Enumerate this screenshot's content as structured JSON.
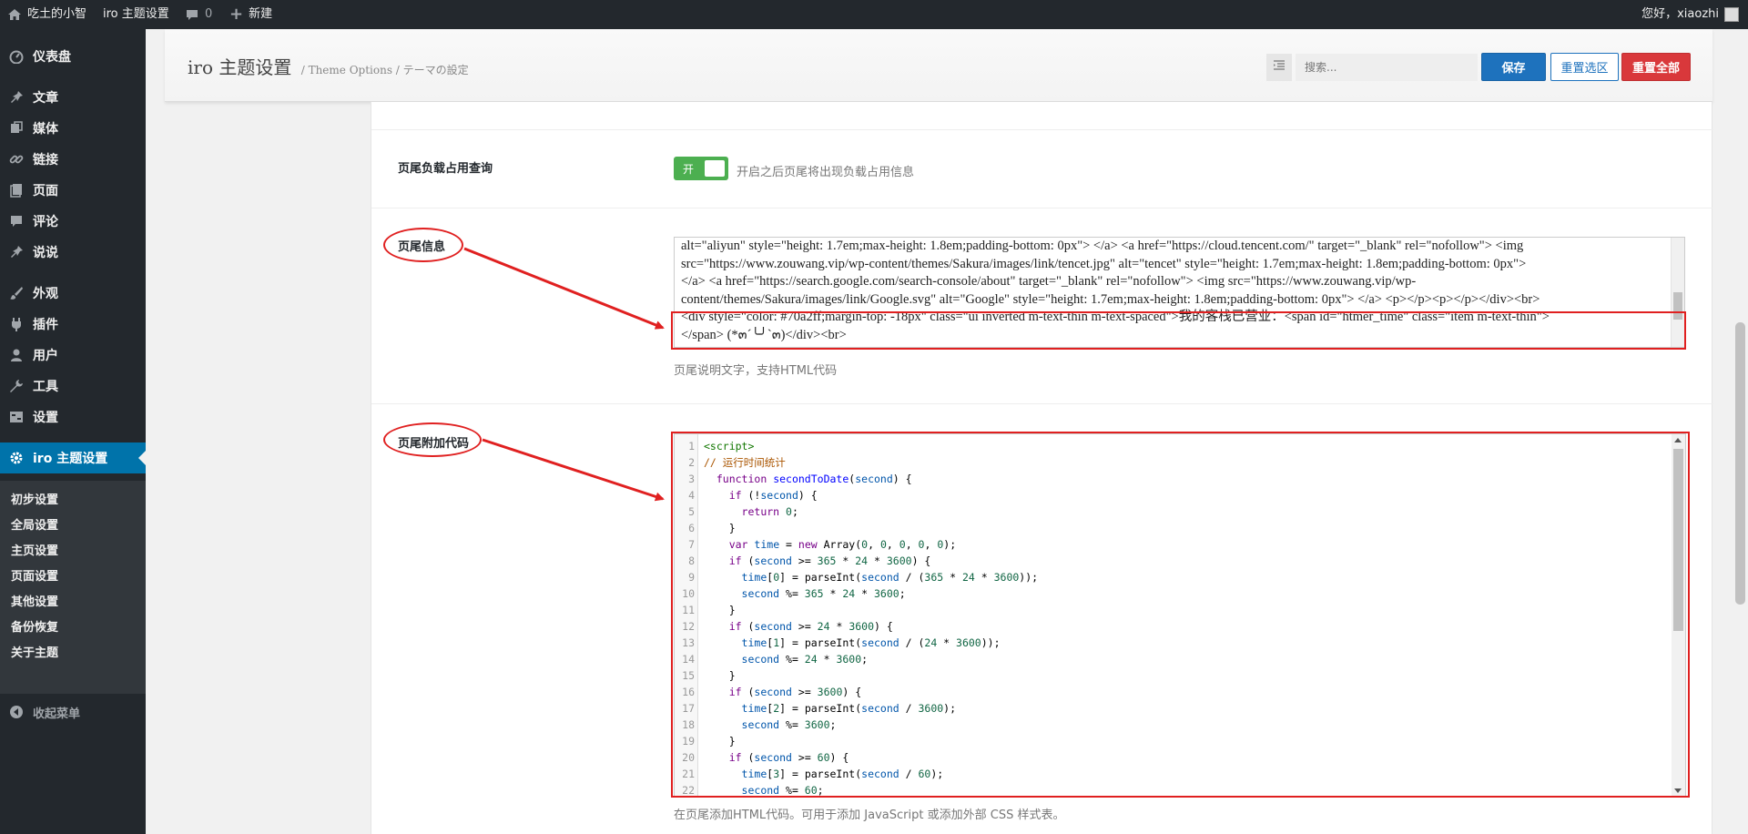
{
  "adminbar": {
    "site_name": "吃土的小智",
    "theme_link": "iro 主题设置",
    "comments_count": "0",
    "new_label": "新建",
    "greeting": "您好，xiaozhi"
  },
  "sidebar": {
    "items": [
      {
        "label": "仪表盘",
        "icon": "dashboard-icon"
      },
      {
        "label": "文章",
        "icon": "pin-icon"
      },
      {
        "label": "媒体",
        "icon": "media-icon"
      },
      {
        "label": "链接",
        "icon": "link-icon"
      },
      {
        "label": "页面",
        "icon": "page-icon"
      },
      {
        "label": "评论",
        "icon": "comment-icon"
      },
      {
        "label": "说说",
        "icon": "pin-icon"
      },
      {
        "label": "外观",
        "icon": "brush-icon"
      },
      {
        "label": "插件",
        "icon": "plugin-icon"
      },
      {
        "label": "用户",
        "icon": "user-icon"
      },
      {
        "label": "工具",
        "icon": "wrench-icon"
      },
      {
        "label": "设置",
        "icon": "settings-icon"
      },
      {
        "label": "iro 主题设置",
        "icon": "gear-icon"
      }
    ],
    "submenu": [
      "初步设置",
      "全局设置",
      "主页设置",
      "页面设置",
      "其他设置",
      "备份恢复",
      "关于主题"
    ],
    "collapse_label": "收起菜单"
  },
  "header": {
    "title": "iro 主题设置",
    "subtitle": "/ Theme Options / テーマの設定",
    "search_placeholder": "搜索...",
    "save_label": "保存",
    "reset_section_label": "重置选区",
    "reset_all_label": "重置全部"
  },
  "fields": {
    "footer_load": {
      "label": "页尾负载占用查询",
      "toggle_label": "开",
      "description": "开启之后页尾将出现负载占用信息"
    },
    "footer_info": {
      "label": "页尾信息",
      "lines": [
        "alt=\"aliyun\" style=\"height: 1.7em;max-height: 1.8em;padding-bottom: 0px\"> </a>    <a href=\"https://cloud.tencent.com/\" target=\"_blank\" rel=\"nofollow\"> <img",
        "src=\"https://www.zouwang.vip/wp-content/themes/Sakura/images/link/tencet.jpg\" alt=\"tencet\" style=\"height: 1.7em;max-height: 1.8em;padding-bottom: 0px\">",
        "</a>    <a href=\"https://search.google.com/search-console/about\" target=\"_blank\" rel=\"nofollow\"> <img src=\"https://www.zouwang.vip/wp-",
        "content/themes/Sakura/images/link/Google.svg\" alt=\"Google\" style=\"height: 1.7em;max-height: 1.8em;padding-bottom: 0px\"> </a>   <p></p><p></p></div><br>",
        "<div style=\"color: #70a2ff;margin-top: -18px\" class=\"ui inverted m-text-thin m-text-spaced\">我的客栈已营业：<span id=\"htmer_time\" class=\"item m-text-thin\">",
        "</span> (*๓´╰╯`๓)</div><br>"
      ],
      "help": "页尾说明文字，支持HTML代码"
    },
    "footer_code": {
      "label": "页尾附加代码",
      "lines": [
        "<script>",
        "// 运行时间统计",
        "  function secondToDate(second) {",
        "    if (!second) {",
        "      return 0;",
        "    }",
        "    var time = new Array(0, 0, 0, 0, 0);",
        "    if (second >= 365 * 24 * 3600) {",
        "      time[0] = parseInt(second / (365 * 24 * 3600));",
        "      second %= 365 * 24 * 3600;",
        "    }",
        "    if (second >= 24 * 3600) {",
        "      time[1] = parseInt(second / (24 * 3600));",
        "      second %= 24 * 3600;",
        "    }",
        "    if (second >= 3600) {",
        "      time[2] = parseInt(second / 3600);",
        "      second %= 3600;",
        "    }",
        "    if (second >= 60) {",
        "      time[3] = parseInt(second / 60);",
        "      second %= 60;"
      ],
      "help": "在页尾添加HTML代码。可用于添加 JavaScript 或添加外部 CSS 样式表。"
    }
  },
  "colors": {
    "annotation": "#e02020",
    "primary": "#1e72bd",
    "danger": "#d9383b",
    "toggle_on": "#4caf50"
  }
}
